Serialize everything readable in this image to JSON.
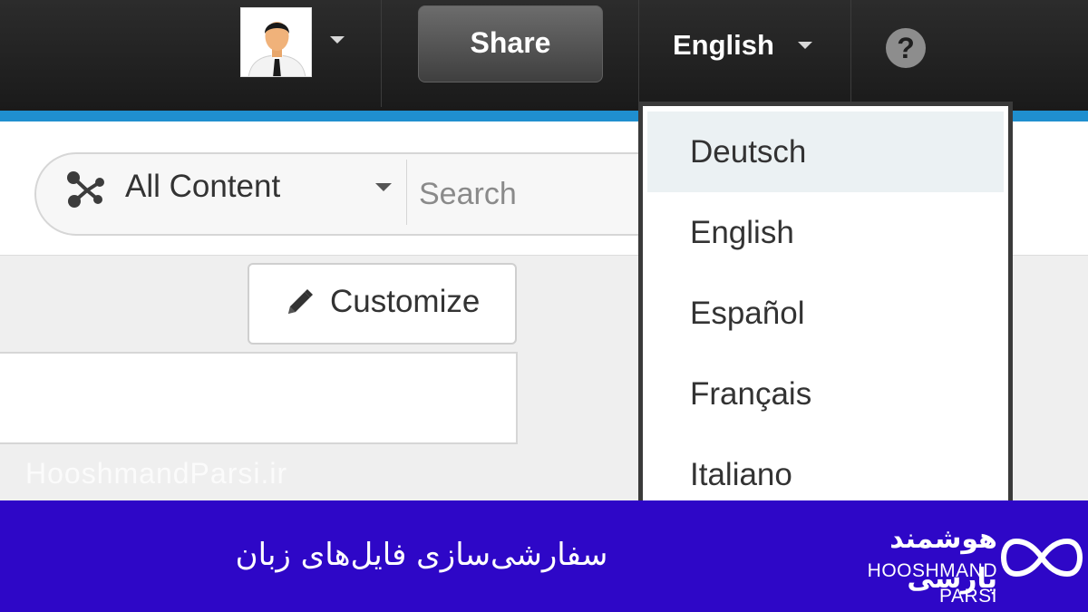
{
  "header": {
    "share_label": "Share",
    "language_label": "English",
    "help_icon": "question-mark-icon",
    "help_glyph": "?",
    "avatar_icon": "user-avatar"
  },
  "search": {
    "scope_label": "All Content",
    "scope_icon": "content-network-icon",
    "placeholder": "Search"
  },
  "toolbar": {
    "customize_label": "Customize",
    "customize_icon": "pencil-icon"
  },
  "language_menu": {
    "items": [
      {
        "label": "Deutsch",
        "highlighted": true
      },
      {
        "label": "English"
      },
      {
        "label": "Español"
      },
      {
        "label": "Français"
      },
      {
        "label": "Italiano"
      }
    ]
  },
  "watermark": "HooshmandParsi.ir",
  "banner": {
    "title": "سفارشی‌سازی فایل‌های زبان",
    "brand_name_fa": "هوشمند پارسی",
    "brand_name_en": "HOOSHMAND PARSI",
    "logo_icon": "infinity-icon"
  },
  "colors": {
    "accent_blue": "#1f8fcf",
    "banner_purple": "#2e07c7",
    "topbar_dark": "#1f1f1f"
  }
}
